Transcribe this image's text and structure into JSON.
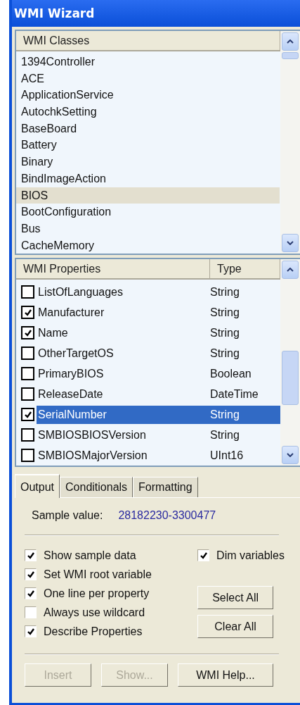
{
  "window": {
    "title": "WMI Wizard"
  },
  "classes": {
    "header": "WMI Classes",
    "items": [
      {
        "label": "1394Controller",
        "selected": false
      },
      {
        "label": "ACE",
        "selected": false
      },
      {
        "label": "ApplicationService",
        "selected": false
      },
      {
        "label": "AutochkSetting",
        "selected": false
      },
      {
        "label": "BaseBoard",
        "selected": false
      },
      {
        "label": "Battery",
        "selected": false
      },
      {
        "label": "Binary",
        "selected": false
      },
      {
        "label": "BindImageAction",
        "selected": false
      },
      {
        "label": "BIOS",
        "selected": true
      },
      {
        "label": "BootConfiguration",
        "selected": false
      },
      {
        "label": "Bus",
        "selected": false
      },
      {
        "label": "CacheMemory",
        "selected": false
      }
    ]
  },
  "properties": {
    "columns": [
      "WMI Properties",
      "Type"
    ],
    "rows": [
      {
        "name": "ListOfLanguages",
        "type": "String",
        "checked": false,
        "selected": false
      },
      {
        "name": "Manufacturer",
        "type": "String",
        "checked": true,
        "selected": false
      },
      {
        "name": "Name",
        "type": "String",
        "checked": true,
        "selected": false
      },
      {
        "name": "OtherTargetOS",
        "type": "String",
        "checked": false,
        "selected": false
      },
      {
        "name": "PrimaryBIOS",
        "type": "Boolean",
        "checked": false,
        "selected": false
      },
      {
        "name": "ReleaseDate",
        "type": "DateTime",
        "checked": false,
        "selected": false
      },
      {
        "name": "SerialNumber",
        "type": "String",
        "checked": true,
        "selected": true
      },
      {
        "name": "SMBIOSBIOSVersion",
        "type": "String",
        "checked": false,
        "selected": false
      },
      {
        "name": "SMBIOSMajorVersion",
        "type": "UInt16",
        "checked": false,
        "selected": false
      }
    ]
  },
  "tabs": [
    {
      "label": "Output",
      "selected": true
    },
    {
      "label": "Conditionals",
      "selected": false
    },
    {
      "label": "Formatting",
      "selected": false
    }
  ],
  "sample": {
    "label": "Sample value:",
    "value": "28182230-3300477"
  },
  "options": [
    {
      "label": "Show sample data",
      "checked": true
    },
    {
      "label": "Set WMI root variable",
      "checked": true
    },
    {
      "label": "One line per property",
      "checked": true
    },
    {
      "label": "Always use wildcard",
      "checked": false
    },
    {
      "label": "Describe Properties",
      "checked": true
    }
  ],
  "dim_option": {
    "label": "Dim variables",
    "checked": true
  },
  "side_buttons": [
    {
      "label": "Select All",
      "disabled": false
    },
    {
      "label": "Clear All",
      "disabled": false
    }
  ],
  "bottom_buttons": [
    {
      "label": "Insert",
      "disabled": true
    },
    {
      "label": "Show...",
      "disabled": true
    },
    {
      "label": "WMI Help...",
      "disabled": false
    }
  ]
}
